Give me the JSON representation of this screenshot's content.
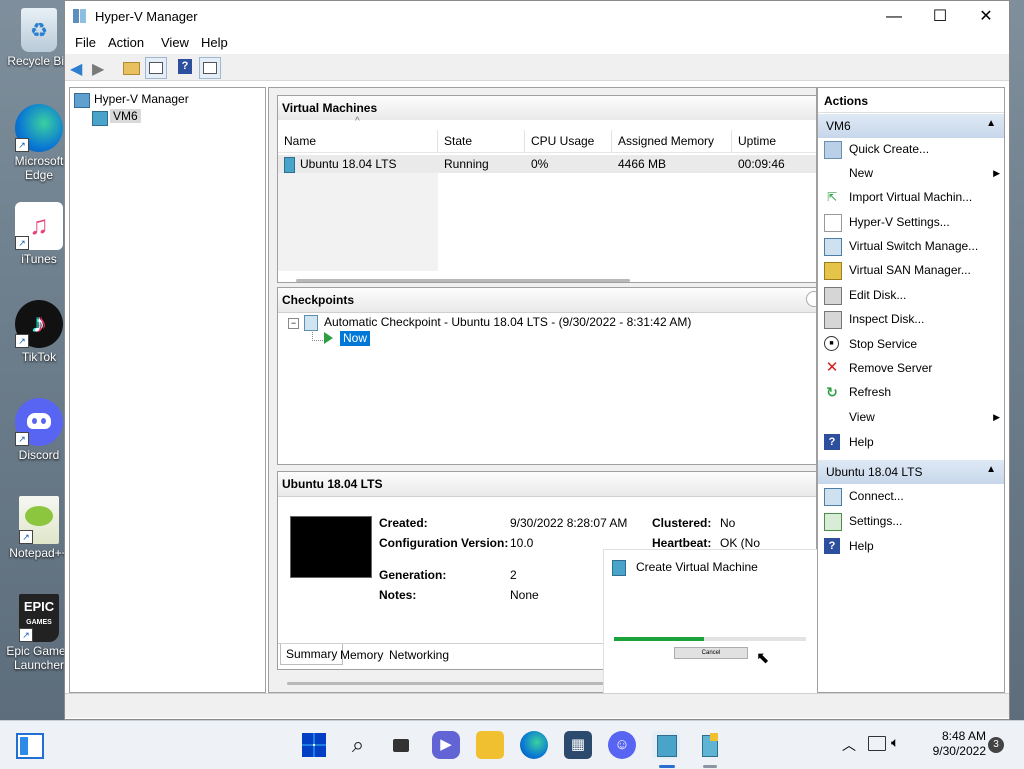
{
  "desktop": {
    "icons": [
      {
        "label": "Recycle Bin",
        "icon": "recycle-bin-icon"
      },
      {
        "label": "Microsoft Edge",
        "icon": "edge-icon"
      },
      {
        "label": "iTunes",
        "icon": "itunes-icon"
      },
      {
        "label": "TikTok",
        "icon": "tiktok-icon"
      },
      {
        "label": "Discord",
        "icon": "discord-icon"
      },
      {
        "label": "Notepad++",
        "icon": "notepadpp-icon"
      },
      {
        "label": "Epic Games Launcher",
        "icon": "epic-games-icon"
      }
    ]
  },
  "window": {
    "title": "Hyper-V Manager",
    "controls": {
      "minimize": "—",
      "maximize": "☐",
      "close": "✕"
    },
    "menu": [
      "File",
      "Action",
      "View",
      "Help"
    ]
  },
  "tree": {
    "root": "Hyper-V Manager",
    "child": "VM6"
  },
  "vm_section": {
    "title": "Virtual Machines",
    "columns": [
      "Name",
      "State",
      "CPU Usage",
      "Assigned Memory",
      "Uptime"
    ],
    "rows": [
      {
        "name": "Ubuntu 18.04 LTS",
        "state": "Running",
        "cpu": "0%",
        "memory": "4466 MB",
        "uptime": "00:09:46"
      }
    ]
  },
  "checkpoints": {
    "title": "Checkpoints",
    "item": "Automatic Checkpoint - Ubuntu 18.04 LTS - (9/30/2022 - 8:31:42 AM)",
    "now": "Now"
  },
  "details": {
    "title": "Ubuntu 18.04 LTS",
    "fields": {
      "created_label": "Created:",
      "created_value": "9/30/2022 8:28:07 AM",
      "config_label": "Configuration Version:",
      "config_value": "10.0",
      "generation_label": "Generation:",
      "generation_value": "2",
      "notes_label": "Notes:",
      "notes_value": "None",
      "clustered_label": "Clustered:",
      "clustered_value": "No",
      "heartbeat_label": "Heartbeat:",
      "heartbeat_value": "OK (No"
    },
    "tabs": [
      "Summary",
      "Memory",
      "Networking"
    ]
  },
  "create_vm_popup": {
    "title": "Create Virtual Machine",
    "cancel": "Cancel"
  },
  "actions": {
    "title": "Actions",
    "group1": {
      "title": "VM6",
      "items": [
        {
          "label": "Quick Create...",
          "icon": "quick-create-icon"
        },
        {
          "label": "New",
          "icon": "",
          "submenu": true
        },
        {
          "label": "Import Virtual Machin...",
          "icon": "import-icon"
        },
        {
          "label": "Hyper-V Settings...",
          "icon": "settings-doc-icon"
        },
        {
          "label": "Virtual Switch Manage...",
          "icon": "switch-icon"
        },
        {
          "label": "Virtual SAN Manager...",
          "icon": "san-icon"
        },
        {
          "label": "Edit Disk...",
          "icon": "edit-disk-icon"
        },
        {
          "label": "Inspect Disk...",
          "icon": "inspect-disk-icon"
        },
        {
          "label": "Stop Service",
          "icon": "stop-icon"
        },
        {
          "label": "Remove Server",
          "icon": "remove-icon"
        },
        {
          "label": "Refresh",
          "icon": "refresh-icon"
        },
        {
          "label": "View",
          "icon": "",
          "submenu": true
        },
        {
          "label": "Help",
          "icon": "help-icon"
        }
      ]
    },
    "group2": {
      "title": "Ubuntu 18.04 LTS",
      "items": [
        {
          "label": "Connect...",
          "icon": "connect-icon"
        },
        {
          "label": "Settings...",
          "icon": "settings-icon"
        },
        {
          "label": "Help",
          "icon": "help-icon"
        }
      ]
    }
  },
  "taskbar": {
    "time": "8:48 AM",
    "date": "9/30/2022",
    "notifications": "3"
  },
  "colors": {
    "accent": "#0078d4",
    "selection": "#0078d7",
    "action_header": "#c7d7ea"
  }
}
